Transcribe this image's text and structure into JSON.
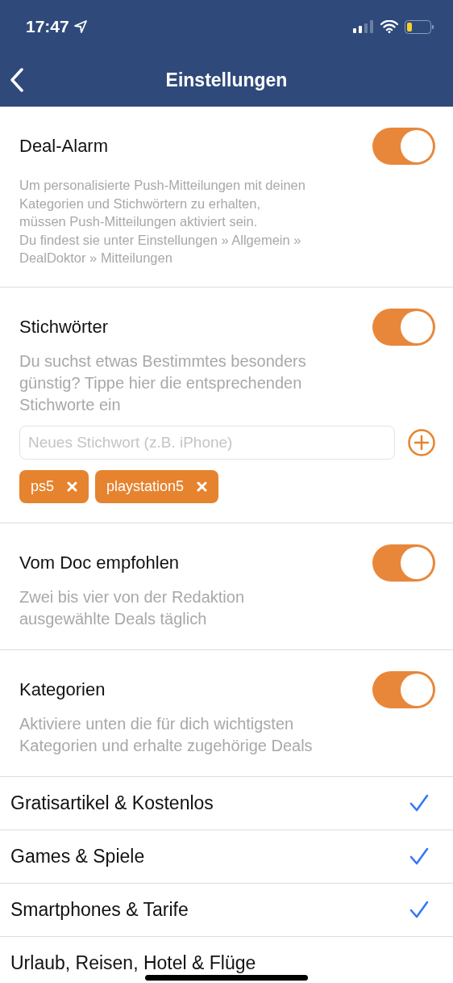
{
  "status_bar": {
    "time": "17:47"
  },
  "nav": {
    "title": "Einstellungen"
  },
  "sections": [
    {
      "kind": "notice",
      "title": "Deal-Alarm",
      "on": true,
      "description": "Um personalisierte Push-Mitteilungen mit deinen\nKategorien und Stichwörtern zu erhalten,\nmüssen Push-Mitteilungen aktiviert sein.\nDu findest sie unter Einstellungen » Allgemein »\nDealDoktor » Mitteilungen"
    },
    {
      "kind": "keywords",
      "title": "Stichwörter",
      "on": true,
      "description": "Du suchst etwas Bestimmtes besonders\ngünstig? Tippe hier die entsprechenden\nStichworte ein",
      "placeholder": "Neues Stichwort (z.B. iPhone)",
      "tags": [
        "ps5",
        "playstation5"
      ]
    },
    {
      "kind": "plain",
      "title": "Vom Doc empfohlen",
      "on": true,
      "description": "Zwei bis vier von der Redaktion\nausgewählte Deals täglich"
    },
    {
      "kind": "plain",
      "title": "Kategorien",
      "on": true,
      "description": "Aktiviere unten die für dich wichtigsten\nKategorien und erhalte zugehörige Deals"
    }
  ],
  "categories": [
    {
      "label": "Gratisartikel & Kostenlos",
      "checked": true
    },
    {
      "label": "Games & Spiele",
      "checked": true
    },
    {
      "label": "Smartphones & Tarife",
      "checked": true
    },
    {
      "label": "Urlaub, Reisen, Hotel & Flüge",
      "checked": false
    }
  ]
}
